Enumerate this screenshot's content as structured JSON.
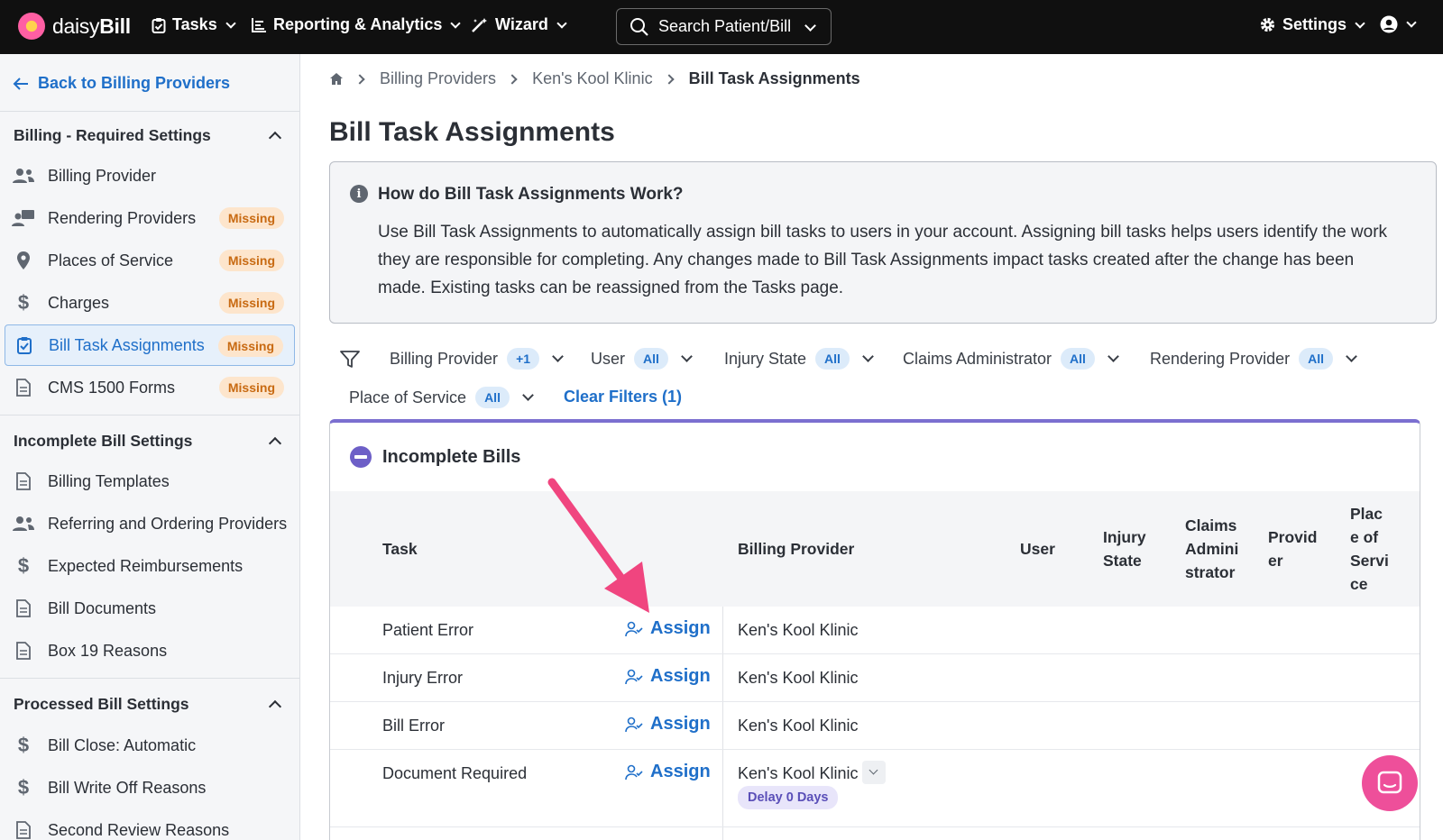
{
  "topbar": {
    "logo_text": "daisyBill",
    "nav": [
      {
        "label": "Tasks",
        "icon": "clipboard-check-icon"
      },
      {
        "label": "Reporting & Analytics",
        "icon": "bar-chart-icon"
      },
      {
        "label": "Wizard",
        "icon": "magic-wand-icon"
      }
    ],
    "search_label": "Search Patient/Bill",
    "settings_label": "Settings"
  },
  "sidebar": {
    "back_label": "Back to Billing Providers",
    "sections": [
      {
        "heading": "Billing - Required Settings",
        "items": [
          {
            "label": "Billing Provider",
            "icon": "users-icon",
            "badge": ""
          },
          {
            "label": "Rendering Providers",
            "icon": "user-board-icon",
            "badge": "Missing"
          },
          {
            "label": "Places of Service",
            "icon": "map-pin-icon",
            "badge": "Missing"
          },
          {
            "label": "Charges",
            "icon": "dollar-icon",
            "badge": "Missing"
          },
          {
            "label": "Bill Task Assignments",
            "icon": "clipboard-check-icon",
            "badge": "Missing",
            "active": true
          },
          {
            "label": "CMS 1500 Forms",
            "icon": "document-icon",
            "badge": "Missing"
          }
        ]
      },
      {
        "heading": "Incomplete Bill Settings",
        "items": [
          {
            "label": "Billing Templates",
            "icon": "document-icon"
          },
          {
            "label": "Referring and Ordering Providers",
            "icon": "users-icon"
          },
          {
            "label": "Expected Reimbursements",
            "icon": "dollar-icon"
          },
          {
            "label": "Bill Documents",
            "icon": "document-icon"
          },
          {
            "label": "Box 19 Reasons",
            "icon": "document-icon"
          }
        ]
      },
      {
        "heading": "Processed Bill Settings",
        "items": [
          {
            "label": "Bill Close: Automatic",
            "icon": "dollar-icon"
          },
          {
            "label": "Bill Write Off Reasons",
            "icon": "dollar-icon"
          },
          {
            "label": "Second Review Reasons",
            "icon": "document-icon"
          }
        ]
      }
    ]
  },
  "breadcrumb": [
    "Billing Providers",
    "Ken's Kool Klinic",
    "Bill Task Assignments"
  ],
  "page_title": "Bill Task Assignments",
  "info": {
    "title": "How do Bill Task Assignments Work?",
    "body": "Use Bill Task Assignments to automatically assign bill tasks to users in your account. Assigning bill tasks helps users identify the work they are responsible for completing. Any changes made to Bill Task Assignments impact tasks created after the change has been made. Existing tasks can be reassigned from the Tasks page."
  },
  "filters": [
    {
      "label": "Billing Provider",
      "value": "+1"
    },
    {
      "label": "User",
      "value": "All"
    },
    {
      "label": "Injury State",
      "value": "All"
    },
    {
      "label": "Claims Administrator",
      "value": "All"
    },
    {
      "label": "Rendering Provider",
      "value": "All"
    },
    {
      "label": "Place of Service",
      "value": "All"
    }
  ],
  "clear_filters_label": "Clear Filters (1)",
  "table": {
    "title": "Incomplete Bills",
    "columns": {
      "task": "Task",
      "billing_provider": "Billing Provider",
      "user": "User",
      "injury_state": "Injury State",
      "claims_admin": "Claims Administrator",
      "provider": "Provider",
      "place_of_service": "Place of Service"
    },
    "assign_label": "Assign",
    "rows": [
      {
        "task": "Patient Error",
        "provider": "Ken's Kool Klinic"
      },
      {
        "task": "Injury Error",
        "provider": "Ken's Kool Klinic"
      },
      {
        "task": "Bill Error",
        "provider": "Ken's Kool Klinic"
      },
      {
        "task": "Document Required",
        "provider": "Ken's Kool Klinic",
        "delay": "Delay 0 Days"
      }
    ]
  },
  "colors": {
    "accent_blue": "#1f6fc9",
    "missing_badge": "#c86a12",
    "card_accent": "#7b6fd0",
    "annotation_arrow": "#f0457f",
    "chat_button": "#ee4f9a"
  }
}
